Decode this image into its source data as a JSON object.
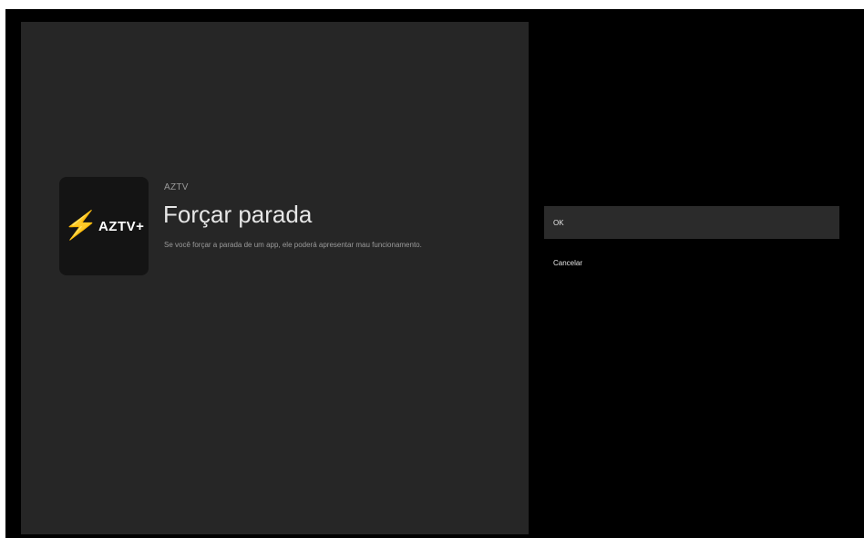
{
  "app": {
    "name": "AZTV",
    "logo_text": "AZTV+",
    "bolt_glyph": "⚡",
    "bolt_color": "#f5a623"
  },
  "dialog": {
    "title": "Forçar parada",
    "description": "Se você forçar a parada de um app, ele poderá apresentar mau funcionamento."
  },
  "actions": {
    "ok_label": "OK",
    "cancel_label": "Cancelar"
  }
}
